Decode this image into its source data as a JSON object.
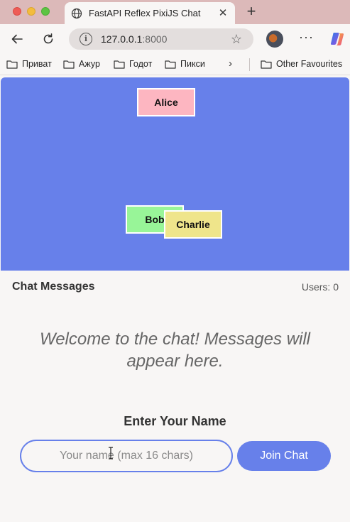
{
  "browser": {
    "tab": {
      "title": "FastAPI Reflex PixiJS Chat",
      "icon": "globe-icon"
    },
    "address": {
      "host": "127.0.0.1",
      "port": ":8000"
    },
    "bookmarks": [
      {
        "label": "Приват",
        "icon": "folder-icon"
      },
      {
        "label": "Ажур",
        "icon": "folder-icon"
      },
      {
        "label": "Годот",
        "icon": "folder-icon"
      },
      {
        "label": "Пикси",
        "icon": "folder-icon"
      }
    ],
    "other_bookmarks": "Other Favourites"
  },
  "stage": {
    "background": "#6780ea",
    "players": [
      {
        "name": "Alice",
        "color": "#fdb6c1"
      },
      {
        "name": "Bob",
        "color": "#98f598"
      },
      {
        "name": "Charlie",
        "color": "#efe58b"
      }
    ]
  },
  "chat": {
    "title": "Chat Messages",
    "users_label": "Users: 0",
    "welcome": "Welcome to the chat! Messages will appear here."
  },
  "join": {
    "title": "Enter Your Name",
    "placeholder": "Your name (max 16 chars)",
    "value": "",
    "button_label": "Join Chat"
  },
  "colors": {
    "accent": "#6780ea",
    "tabstrip": "#dcb9b9"
  }
}
